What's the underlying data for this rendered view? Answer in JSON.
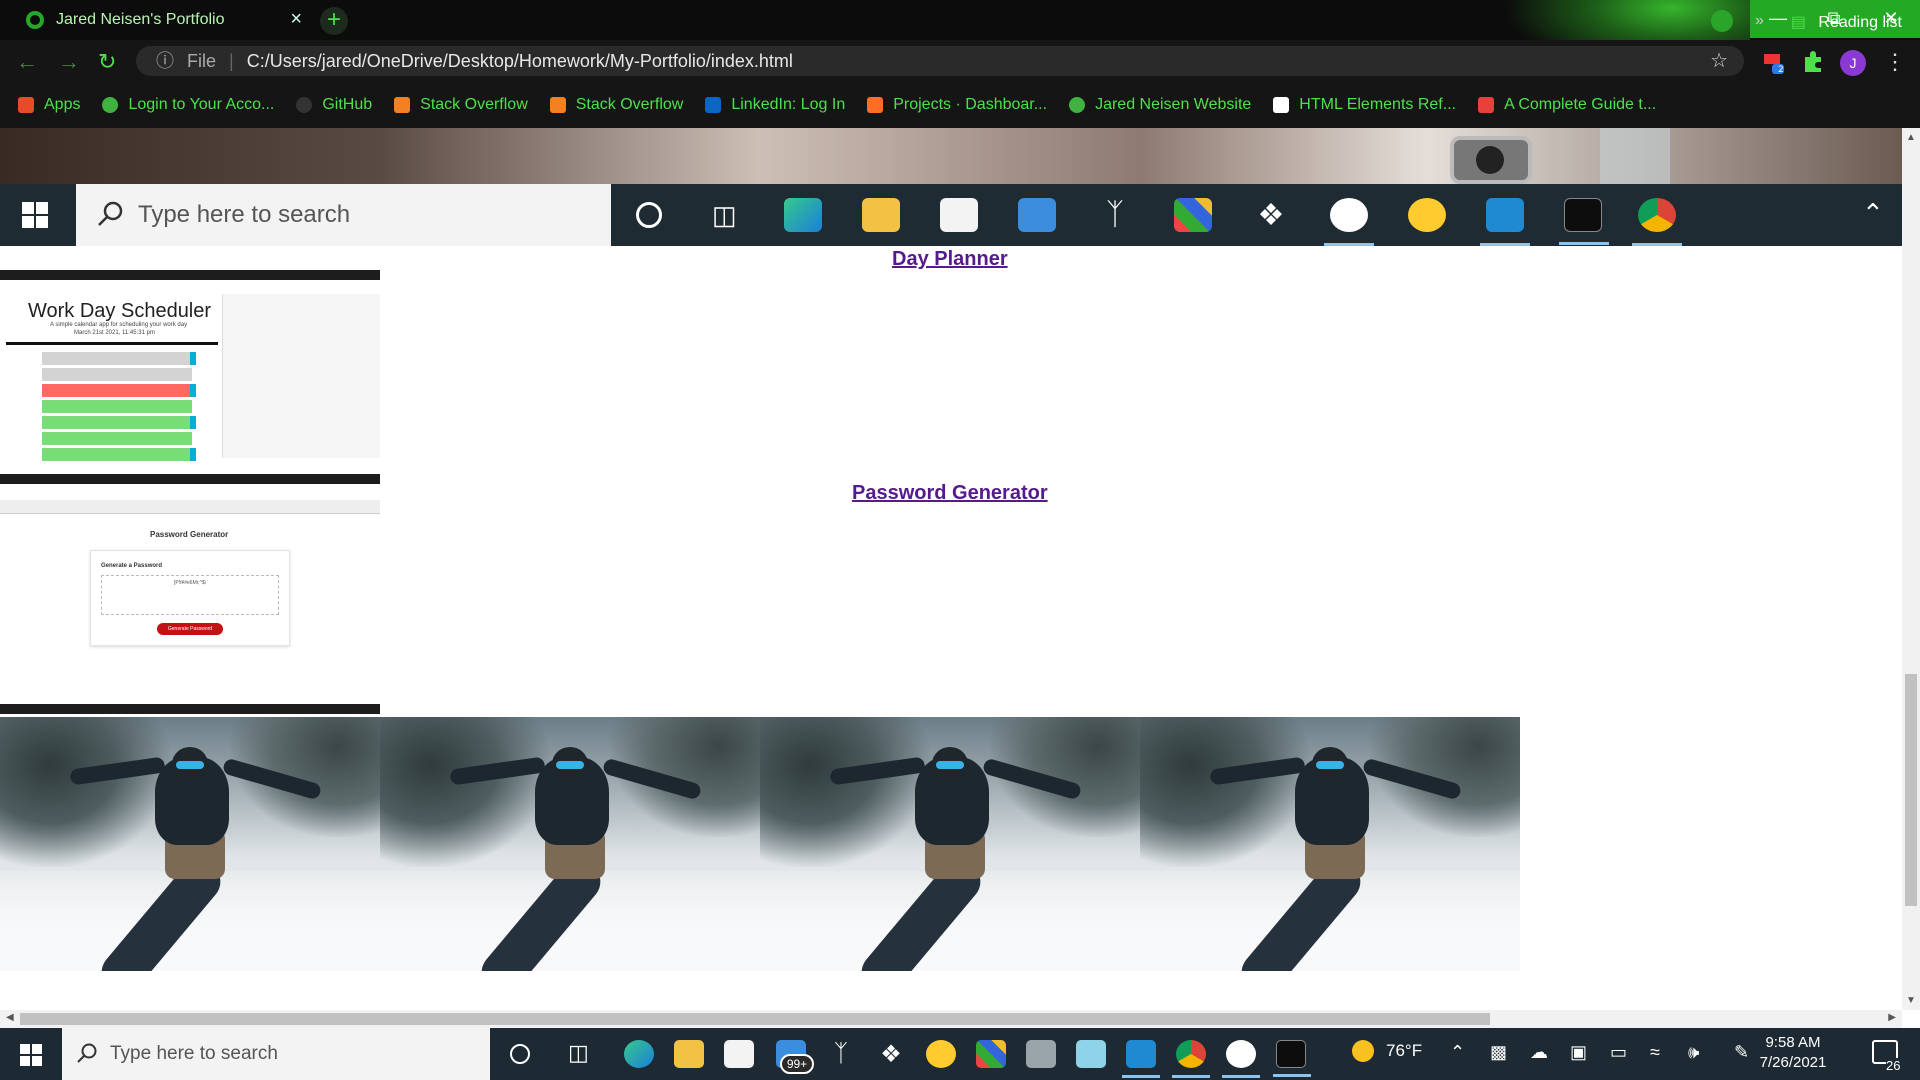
{
  "browser": {
    "tab_title": "Jared Neisen's Portfolio",
    "tab_close": "×",
    "new_tab": "+",
    "address": {
      "scheme_label": "File",
      "url": "C:/Users/jared/OneDrive/Desktop/Homework/My-Portfolio/index.html"
    },
    "profile_initial": "J",
    "extension_badge": "2",
    "bookmarks": [
      {
        "label": "Apps",
        "icon": "apps-grid-icon",
        "color": "#e44d26"
      },
      {
        "label": "Login to Your Acco...",
        "icon": "globe-icon",
        "color": "#3fb23f"
      },
      {
        "label": "GitHub",
        "icon": "github-icon",
        "color": "#333333"
      },
      {
        "label": "Stack Overflow",
        "icon": "stackoverflow-icon",
        "color": "#f48024"
      },
      {
        "label": "Stack Overflow",
        "icon": "stackoverflow-icon",
        "color": "#f48024"
      },
      {
        "label": "LinkedIn: Log In",
        "icon": "linkedin-icon",
        "color": "#0a66c2"
      },
      {
        "label": "Projects · Dashboar...",
        "icon": "gitlab-icon",
        "color": "#fc6d26"
      },
      {
        "label": "Jared Neisen Website",
        "icon": "globe-icon",
        "color": "#3fb23f"
      },
      {
        "label": "HTML Elements Ref...",
        "icon": "mdn-icon",
        "color": "#ffffff"
      },
      {
        "label": "A Complete Guide t...",
        "icon": "asterisk-icon",
        "color": "#e8403a"
      }
    ],
    "bookmarks_more": "»",
    "reading_list": "Reading list"
  },
  "inner_taskbar": {
    "search_placeholder": "Type here to search"
  },
  "page": {
    "projects": [
      {
        "title": "Day Planner",
        "thumb": {
          "heading": "Work Day Scheduler",
          "subheading": "A simple calendar app for scheduling your work day",
          "date": "March 21st 2021, 11:45:31 pm"
        }
      },
      {
        "title": "Password Generator",
        "thumb": {
          "heading": "Password Generator",
          "card_title": "Generate a Password",
          "password": "[P!t¥#e6Mr,^$\\",
          "button": "Generate Password"
        }
      }
    ],
    "gallery_count": 4
  },
  "taskbar": {
    "search_placeholder": "Type here to search",
    "mail_badge": "99+",
    "weather": "76°F",
    "time": "9:58 AM",
    "date": "7/26/2021",
    "notifications": "26"
  },
  "colors": {
    "accent_green": "#4de04a",
    "link_visited": "#551a8b",
    "taskbar_bg": "#1e2a33",
    "win_controls": "#23a923"
  }
}
